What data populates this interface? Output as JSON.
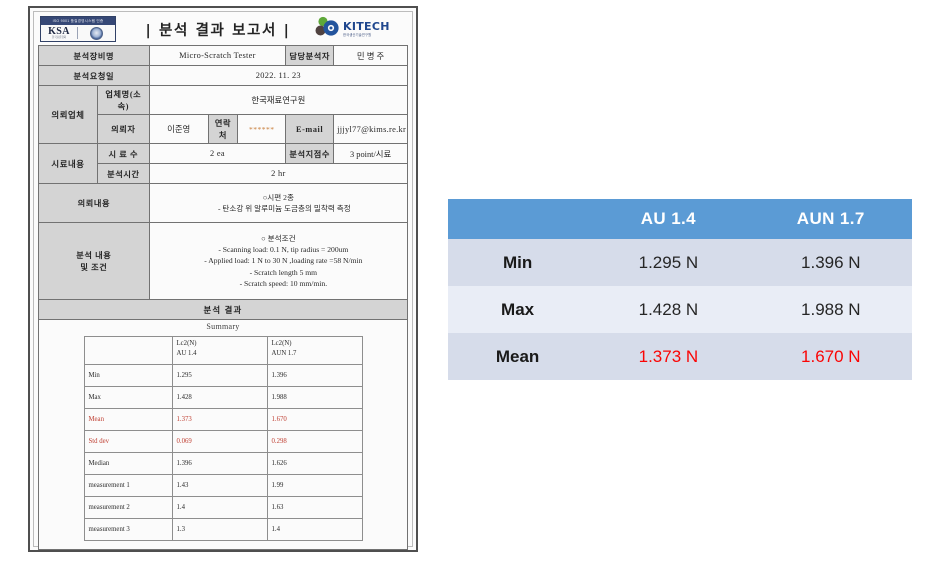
{
  "document": {
    "title": "| 분석 결과 보고서 |",
    "ksa_logo": {
      "band_text": "ISO 9001 품질경영시스템 인증",
      "word": "KSA",
      "subword": "한국표준협회"
    },
    "kitech_logo": {
      "name": "KITECH",
      "subtitle": "한국생산기술연구원"
    },
    "rows": {
      "equipment_label": "분석장비명",
      "equipment_value": "Micro-Scratch Tester",
      "analyst_label": "담당분석자",
      "analyst_value": "민 병 주",
      "request_date_label": "분석요청일",
      "request_date_value": "2022. 11. 23",
      "client_label": "의뢰업체",
      "company_label": "업체명(소속)",
      "company_value": "한국재료연구원",
      "requester_label": "의뢰자",
      "requester_value": "이준영",
      "contact_label": "연락처",
      "contact_value": "******",
      "email_label": "E-mail",
      "email_value": "jjjyl77@kims.re.kr",
      "sample_label": "시료내용",
      "sample_count_label": "시 료 수",
      "sample_count_value": "2 ea",
      "points_label": "분석지점수",
      "points_value": "3 point/시료",
      "analysis_time_label": "분석시간",
      "analysis_time_value": "2 hr",
      "request_content_label": "의뢰내용",
      "request_content_line1": "○시편 2종",
      "request_content_line2": "- 탄소강 위 알루미늄 도금층의 밀착력 측정",
      "conditions_label": "분석 내용\n및 조건",
      "conditions_label_line1": "분석 내용",
      "conditions_label_line2": "및 조건",
      "conditions_line0": "○ 분석조건",
      "conditions_line1": "- Scanning load: 0.1 N, tip radius = 200um",
      "conditions_line2": "- Applied load: 1 N to 30 N ,loading rate =58 N/min",
      "conditions_line3": "- Scratch length 5 mm",
      "conditions_line4": "- Scratch speed: 10 mm/min.",
      "results_band": "분석 결과",
      "summary_word": "Summary"
    },
    "inner_table": {
      "header": [
        "",
        "Lc2(N)\nAU 1.4",
        "Lc2(N)\nAUN 1.7"
      ],
      "header_col1_line1": "Lc2(N)",
      "header_col1_line2": "AU 1.4",
      "header_col2_line1": "Lc2(N)",
      "header_col2_line2": "AUN 1.7",
      "rows": [
        {
          "label": "Min",
          "au": "1.295",
          "aun": "1.396",
          "red": false
        },
        {
          "label": "Max",
          "au": "1.428",
          "aun": "1.988",
          "red": false
        },
        {
          "label": "Mean",
          "au": "1.373",
          "aun": "1.670",
          "red": true
        },
        {
          "label": "Std dev",
          "au": "0.069",
          "aun": "0.298",
          "red": true
        },
        {
          "label": "Median",
          "au": "1.396",
          "aun": "1.626",
          "red": false
        },
        {
          "label": "measurement 1",
          "au": "1.43",
          "aun": "1.99",
          "red": false
        },
        {
          "label": "measurement 2",
          "au": "1.4",
          "aun": "1.63",
          "red": false
        },
        {
          "label": "measurement 3",
          "au": "1.3",
          "aun": "1.4",
          "red": false
        }
      ]
    }
  },
  "summary_table": {
    "columns": [
      "",
      "AU 1.4",
      "AUN 1.7"
    ],
    "col1_header": "AU 1.4",
    "col2_header": "AUN 1.7",
    "rows": [
      {
        "label": "Min",
        "au": "1.295 N",
        "aun": "1.396 N",
        "red": false
      },
      {
        "label": "Max",
        "au": "1.428 N",
        "aun": "1.988 N",
        "red": false
      },
      {
        "label": "Mean",
        "au": "1.373 N",
        "aun": "1.670 N",
        "red": true
      }
    ],
    "colors": {
      "header_blue": "#5b9bd5",
      "band_a": "#d6dcea",
      "band_b": "#e9edf6",
      "red_text": "#fa0505"
    }
  }
}
